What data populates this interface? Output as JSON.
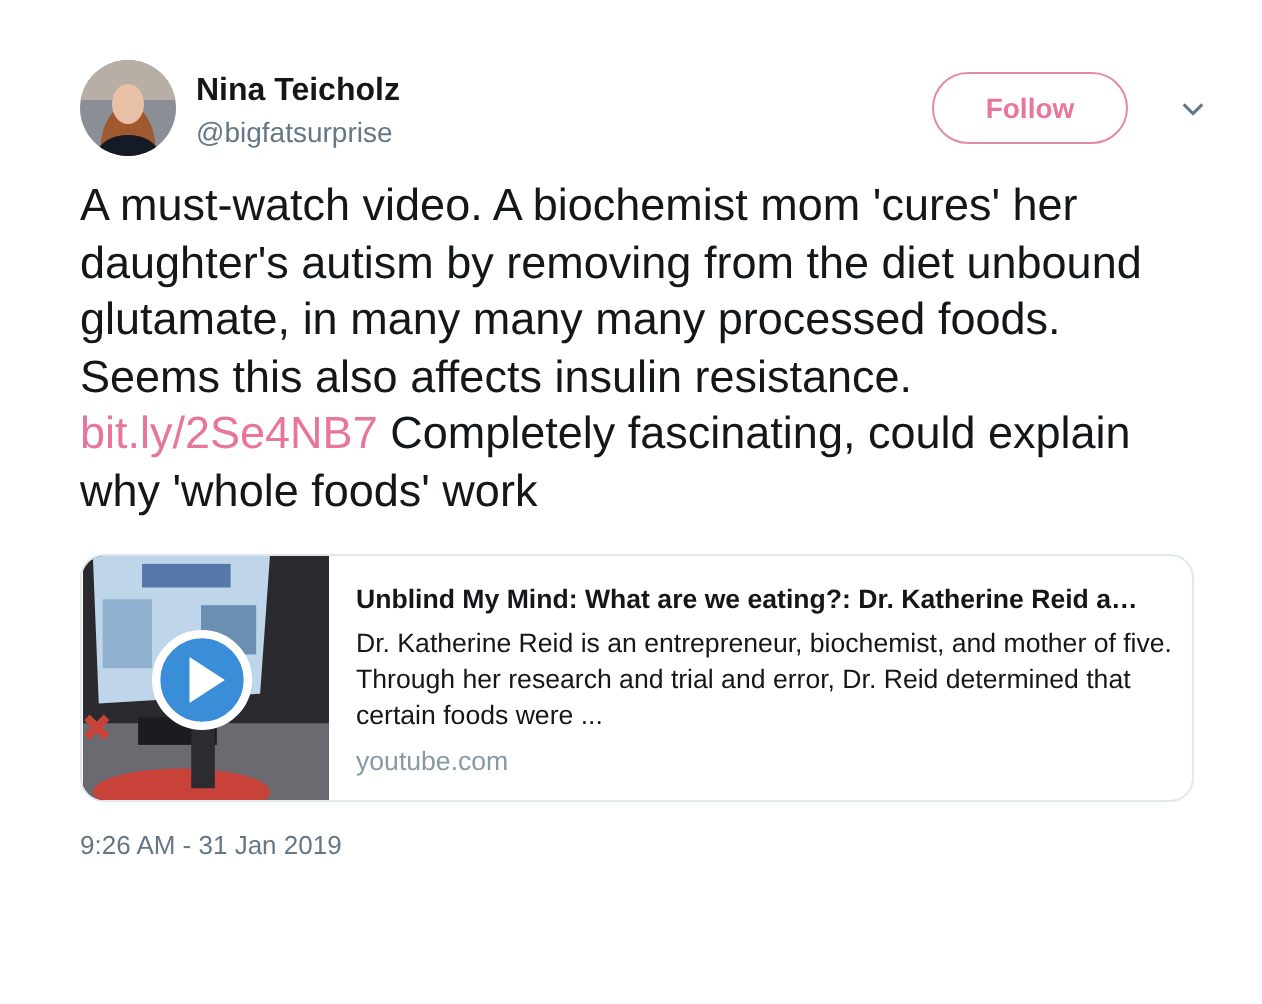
{
  "author": {
    "name": "Nina Teicholz",
    "handle": "@bigfatsurprise"
  },
  "follow_button": {
    "label": "Follow"
  },
  "tweet_text": [
    {
      "kind": "text",
      "text": "A must-watch video. A biochemist mom 'cures' her daughter's autism by removing from the diet unbound glutamate, in many many many processed foods. Seems this also affects insulin resistance. "
    },
    {
      "kind": "link",
      "text": "bit.ly/2Se4NB7"
    },
    {
      "kind": "text",
      "text": " Completely fascinating, could explain why 'whole foods' work"
    }
  ],
  "link_card": {
    "title": "Unblind My Mind: What are we eating?: Dr. Katherine Reid a…",
    "description": "Dr. Katherine Reid is an entrepreneur, biochemist, and mother of five. Through her research and trial and error, Dr. Reid determined that certain foods were ...",
    "domain": "youtube.com"
  },
  "timestamp": "9:26 AM - 31 Jan 2019"
}
